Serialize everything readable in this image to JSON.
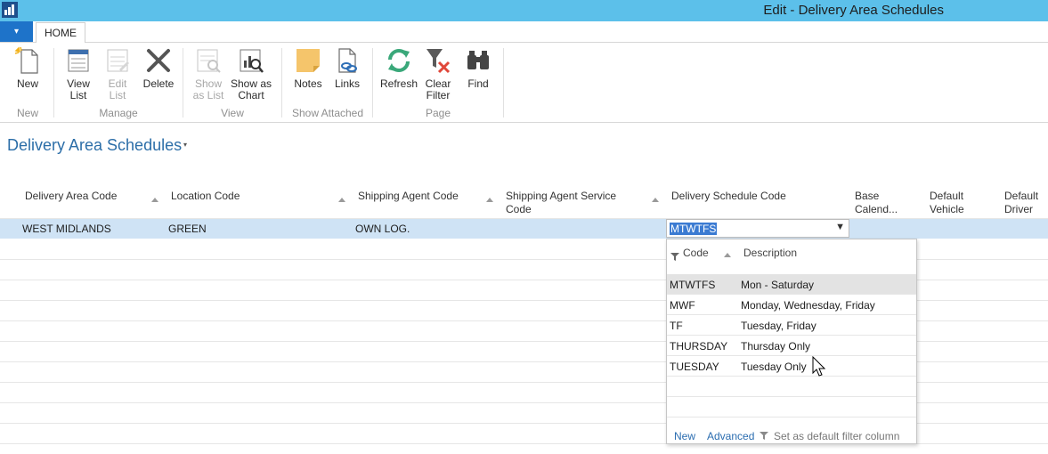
{
  "window": {
    "title": "Edit - Delivery Area Schedules"
  },
  "tabs": {
    "file_glyph": "▾",
    "home": "HOME"
  },
  "ribbon": {
    "buttons": {
      "new": "New",
      "view_list_1": "View",
      "view_list_2": "List",
      "edit_list_1": "Edit",
      "edit_list_2": "List",
      "delete": "Delete",
      "show_list_1": "Show",
      "show_list_2": "as List",
      "show_chart_1": "Show as",
      "show_chart_2": "Chart",
      "notes": "Notes",
      "links": "Links",
      "refresh": "Refresh",
      "clear_filter_1": "Clear",
      "clear_filter_2": "Filter",
      "find": "Find"
    },
    "groups": {
      "new": "New",
      "manage": "Manage",
      "view": "View",
      "show_attached": "Show Attached",
      "page": "Page"
    }
  },
  "page": {
    "title": "Delivery Area Schedules",
    "caret": "▾"
  },
  "table": {
    "headers": {
      "delivery_area_code": "Delivery Area Code",
      "location_code": "Location Code",
      "shipping_agent_code": "Shipping Agent Code",
      "shipping_agent_service_1": "Shipping Agent Service",
      "shipping_agent_service_2": "Code",
      "delivery_schedule_code": "Delivery Schedule Code",
      "base_calendar_1": "Base",
      "base_calendar_2": "Calend...",
      "default_vehicle_1": "Default",
      "default_vehicle_2": "Vehicle",
      "default_driver_1": "Default",
      "default_driver_2": "Driver"
    },
    "row": {
      "delivery_area_code": "WEST MIDLANDS",
      "location_code": "GREEN",
      "shipping_agent_code": "OWN LOG.",
      "delivery_schedule_code": "MTWTFS"
    }
  },
  "dropdown": {
    "headers": {
      "code": "Code",
      "description": "Description"
    },
    "items": [
      {
        "code": "MTWTFS",
        "description": "Mon - Saturday"
      },
      {
        "code": "MWF",
        "description": "Monday, Wednesday, Friday"
      },
      {
        "code": "TF",
        "description": "Tuesday, Friday"
      },
      {
        "code": "THURSDAY",
        "description": "Thursday Only"
      },
      {
        "code": "TUESDAY",
        "description": "Tuesday Only"
      }
    ],
    "footer": {
      "new": "New",
      "advanced": "Advanced",
      "set_default": "Set as default filter column"
    }
  },
  "colors": {
    "titlebar": "#5cc0ea",
    "file_button": "#1e73c9",
    "title_link": "#2c6ea8",
    "selected_row": "#cfe3f5",
    "text_selection": "#3b7bd2"
  }
}
